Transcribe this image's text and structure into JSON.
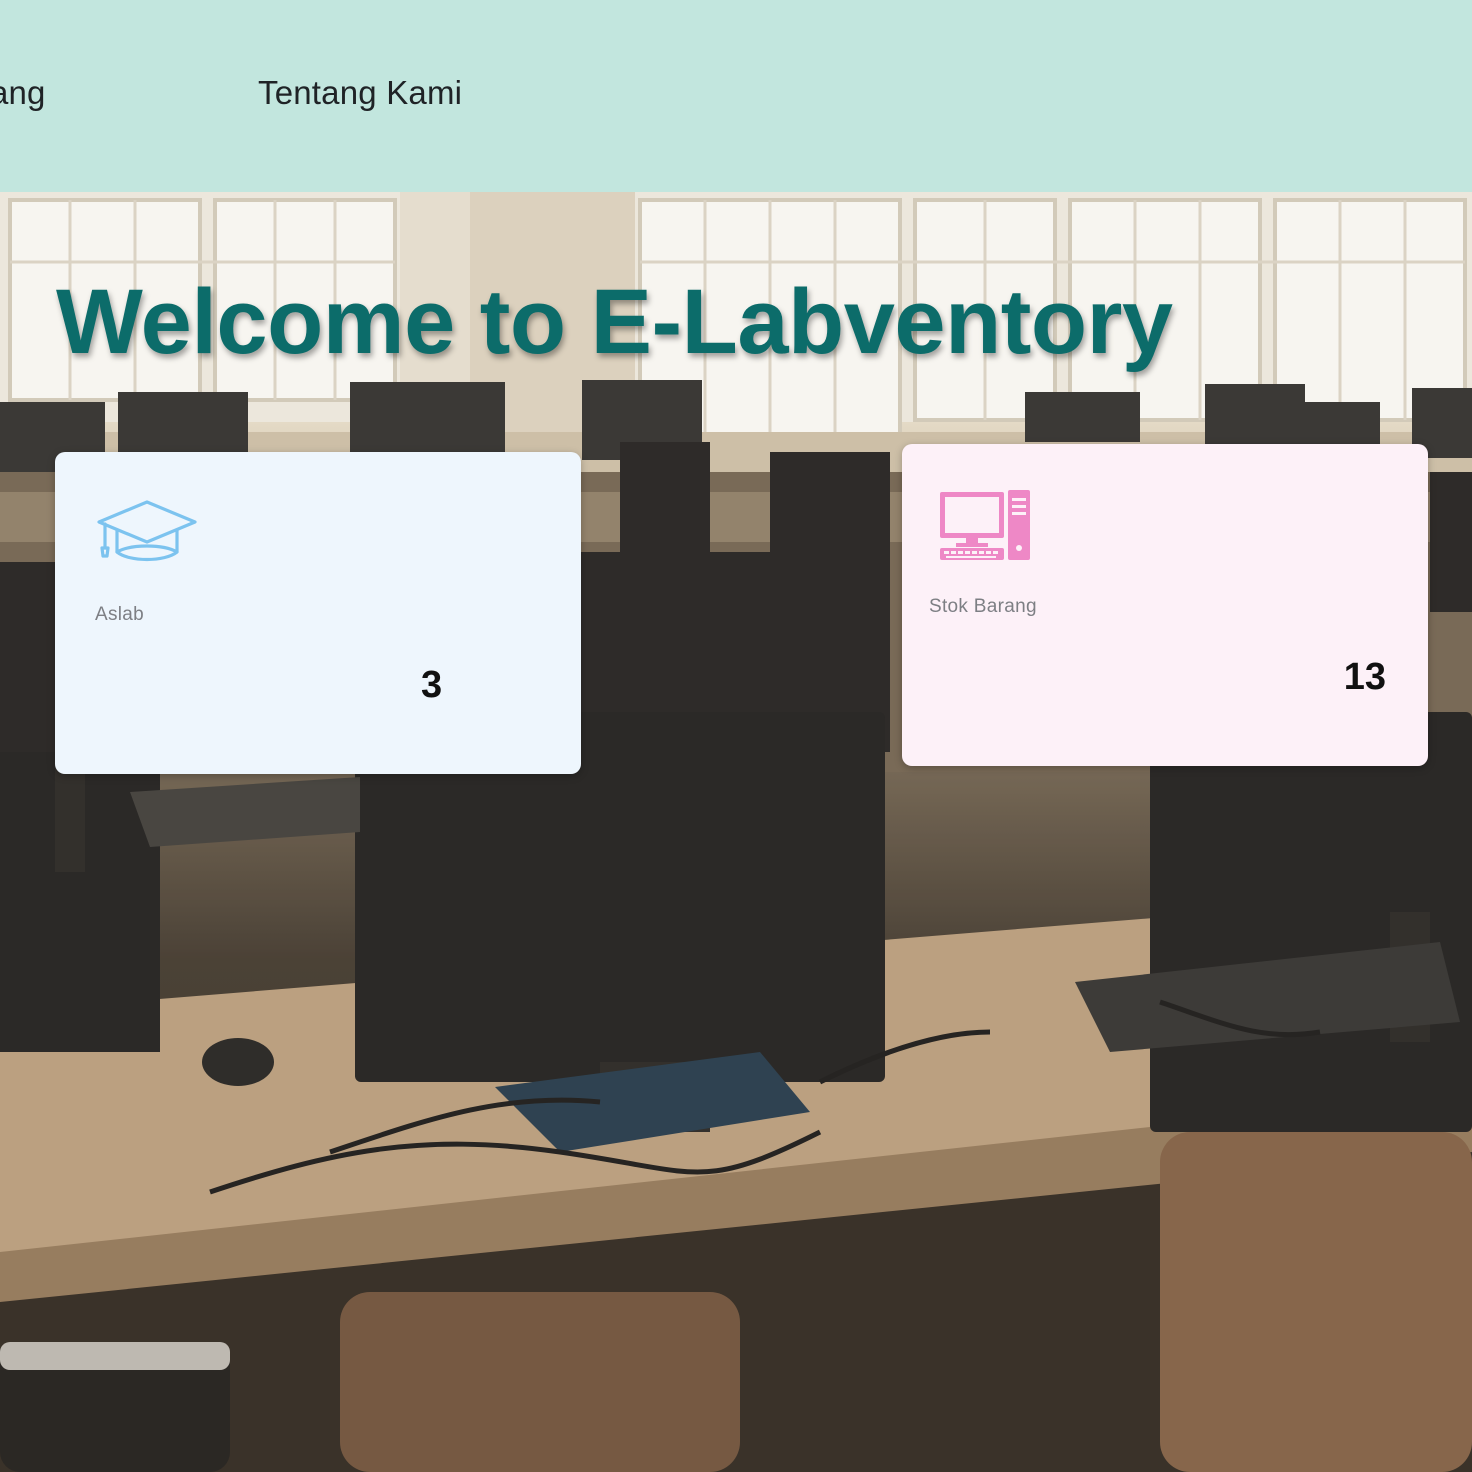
{
  "nav": {
    "items": [
      {
        "label": "Barang"
      },
      {
        "label": "Tentang Kami"
      }
    ]
  },
  "hero": {
    "title": "Welcome to E-Labventory",
    "background": "computer-lab-photo"
  },
  "cards": {
    "aslab": {
      "icon": "graduation-cap-icon",
      "label": "Aslab",
      "value": "3",
      "background": "#eef6fd",
      "accent": "#7cc3ef"
    },
    "stok": {
      "icon": "desktop-computer-icon",
      "label": "Stok Barang",
      "value": "13",
      "background": "#fdf1f8",
      "accent": "#ee88c6"
    }
  },
  "colors": {
    "navbar": "#c2e6de",
    "title": "#0c6c6a"
  }
}
